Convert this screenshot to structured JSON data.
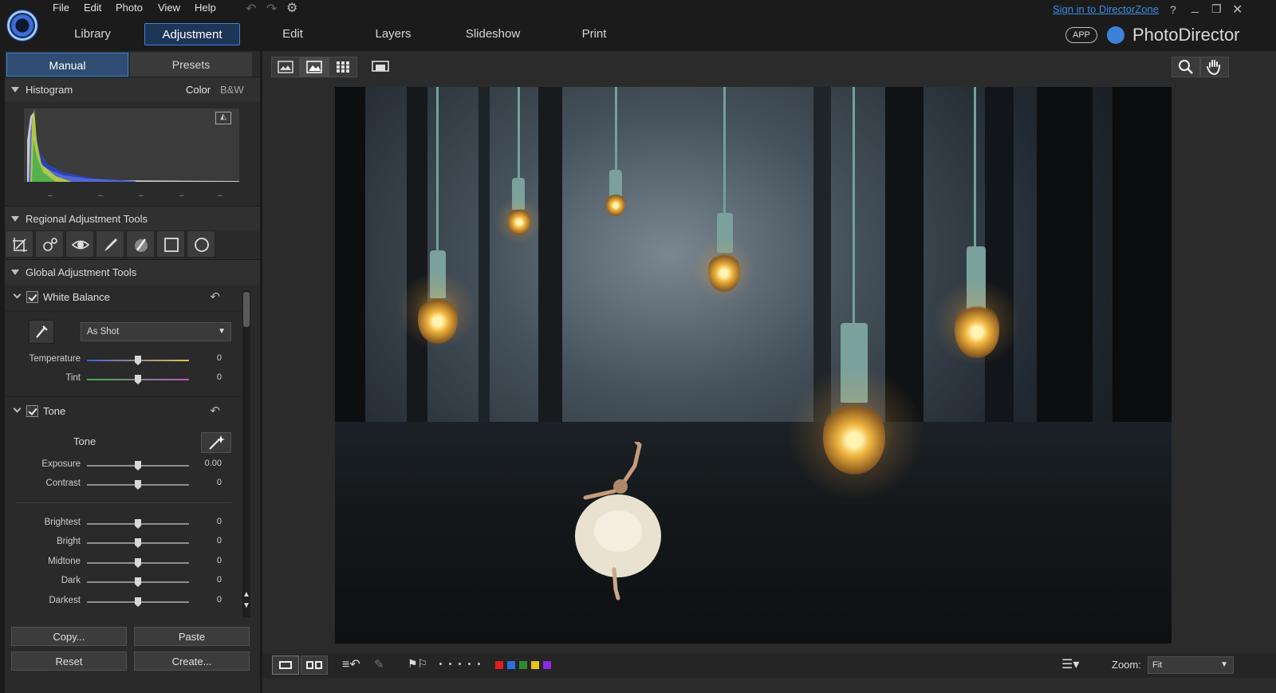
{
  "app": {
    "name": "PhotoDirector",
    "app_badge": "APP",
    "sign_in": "Sign in to DirectorZone"
  },
  "menu": [
    "File",
    "Edit",
    "Photo",
    "View",
    "Help"
  ],
  "tabs": [
    "Library",
    "Adjustment",
    "Edit",
    "Layers",
    "Slideshow",
    "Print"
  ],
  "active_tab": "Adjustment",
  "subtabs": {
    "manual": "Manual",
    "presets": "Presets"
  },
  "histogram": {
    "title": "Histogram",
    "color": "Color",
    "bw": "B&W",
    "ticks": [
      "–",
      "–",
      "–",
      "–",
      "–"
    ]
  },
  "regional": {
    "title": "Regional Adjustment Tools"
  },
  "global": {
    "title": "Global Adjustment Tools"
  },
  "white_balance": {
    "title": "White Balance",
    "preset": "As Shot",
    "sliders": [
      {
        "label": "Temperature",
        "value": "0",
        "pos": 0.5
      },
      {
        "label": "Tint",
        "value": "0",
        "pos": 0.5
      }
    ]
  },
  "tone": {
    "title": "Tone",
    "sub_label": "Tone",
    "sliders": [
      {
        "label": "Exposure",
        "value": "0.00",
        "pos": 0.5
      },
      {
        "label": "Contrast",
        "value": "0",
        "pos": 0.5
      },
      {
        "label": "Brightest",
        "value": "0",
        "pos": 0.5
      },
      {
        "label": "Bright",
        "value": "0",
        "pos": 0.5
      },
      {
        "label": "Midtone",
        "value": "0",
        "pos": 0.5
      },
      {
        "label": "Dark",
        "value": "0",
        "pos": 0.5
      },
      {
        "label": "Darkest",
        "value": "0",
        "pos": 0.5
      }
    ]
  },
  "buttons": {
    "copy": "Copy...",
    "paste": "Paste",
    "reset": "Reset",
    "create": "Create..."
  },
  "zoom": {
    "label": "Zoom:",
    "value": "Fit"
  },
  "color_labels": [
    "#e02020",
    "#2a6fe0",
    "#2f8a2f",
    "#e6c21a",
    "#8a2be2"
  ],
  "accent": "#3d82d9"
}
